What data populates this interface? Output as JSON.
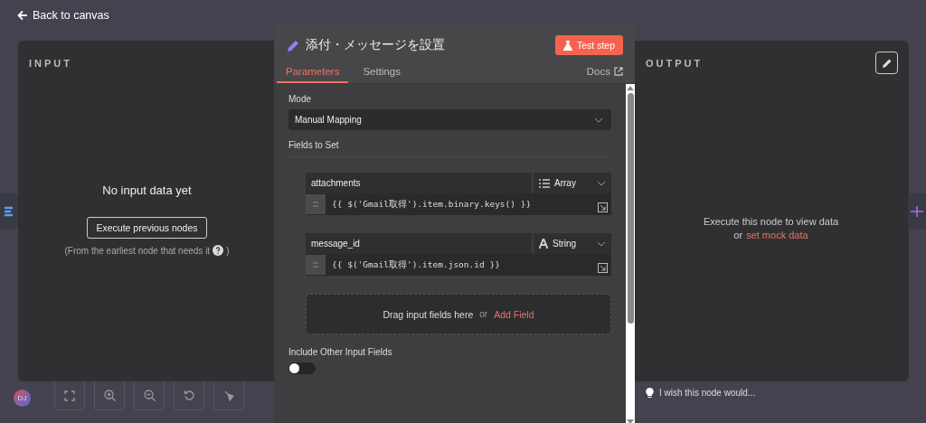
{
  "top_bar": {
    "back_link": "Back to canvas"
  },
  "input_panel": {
    "title": "INPUT",
    "heading": "No input data yet",
    "button": "Execute previous nodes",
    "hint_before": "(From the earliest node that needs it",
    "hint_after": ")"
  },
  "canvas_toolbar": {
    "avatar": "DJ"
  },
  "node_dialog": {
    "title": "添付・メッセージを設置",
    "test_button": "Test step",
    "tabs": [
      {
        "label": "Parameters",
        "selected": true
      },
      {
        "label": "Settings",
        "selected": false
      }
    ],
    "docs_link": "Docs",
    "mode_label": "Mode",
    "mode_value": "Manual Mapping",
    "fields_label": "Fields to Set",
    "assignments": [
      {
        "name": "attachments",
        "type": "Array",
        "kind": "array",
        "value": "{{ $('Gmail取得').item.binary.keys() }}"
      },
      {
        "name": "message_id",
        "type": "String",
        "kind": "string",
        "value": "{{ $('Gmail取得').item.json.id }}"
      }
    ],
    "drop_zone": {
      "text": "Drag input fields here",
      "separator": "or",
      "link": "Add Field"
    },
    "include_label": "Include Other Input Fields",
    "include_on": false
  },
  "output_panel": {
    "title": "OUTPUT",
    "message": "Execute this node to view data",
    "separator": "or",
    "mock_link": "set mock data"
  },
  "feedback": "I wish this node would..."
}
